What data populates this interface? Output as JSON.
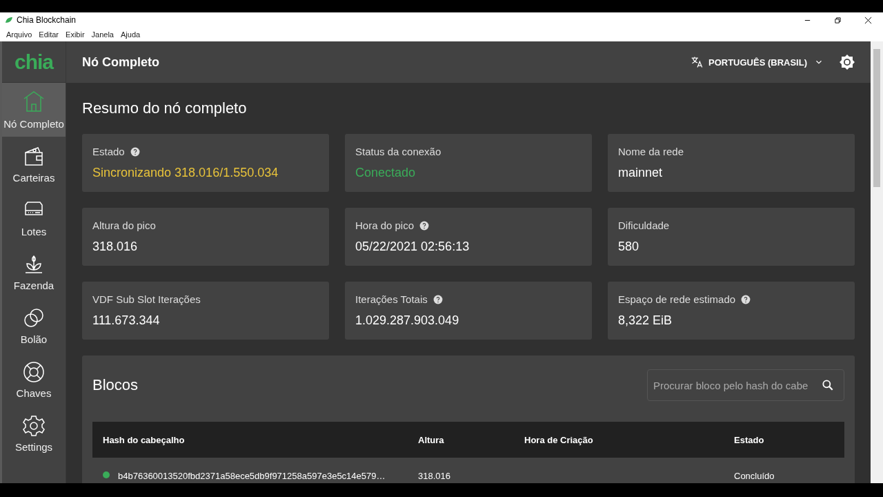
{
  "window": {
    "title": "Chia Blockchain"
  },
  "menu": [
    "Arquivo",
    "Editar",
    "Exibir",
    "Janela",
    "Ajuda"
  ],
  "logo": "chia",
  "header": {
    "title": "Nó Completo",
    "language": "PORTUGUÊS (BRASIL)"
  },
  "sidebar": {
    "items": [
      {
        "label": "Nó Completo",
        "selected": true
      },
      {
        "label": "Carteiras",
        "selected": false
      },
      {
        "label": "Lotes",
        "selected": false
      },
      {
        "label": "Fazenda",
        "selected": false
      },
      {
        "label": "Bolão",
        "selected": false
      },
      {
        "label": "Chaves",
        "selected": false
      },
      {
        "label": "Settings",
        "selected": false
      }
    ]
  },
  "summary": {
    "title": "Resumo do nó completo",
    "cards": [
      {
        "label": "Estado",
        "help": true,
        "value": "Sincronizando 318.016/1.550.034",
        "color": "#e8c33a"
      },
      {
        "label": "Status da conexão",
        "help": false,
        "value": "Conectado",
        "color": "#3aac59"
      },
      {
        "label": "Nome da rede",
        "help": false,
        "value": "mainnet",
        "color": "#ffffff"
      },
      {
        "label": "Altura do pico",
        "help": false,
        "value": "318.016",
        "color": "#ffffff"
      },
      {
        "label": "Hora do pico",
        "help": true,
        "value": "05/22/2021 02:56:13",
        "color": "#ffffff"
      },
      {
        "label": "Dificuldade",
        "help": false,
        "value": "580",
        "color": "#ffffff"
      },
      {
        "label": "VDF Sub Slot Iterações",
        "help": false,
        "value": "111.673.344",
        "color": "#ffffff"
      },
      {
        "label": "Iterações Totais",
        "help": true,
        "value": "1.029.287.903.049",
        "color": "#ffffff"
      },
      {
        "label": "Espaço de rede estimado",
        "help": true,
        "value": "8,322 EiB",
        "color": "#ffffff"
      }
    ]
  },
  "blocks": {
    "title": "Blocos",
    "search": {
      "placeholder": "Procurar bloco pelo hash do cabe"
    },
    "table": {
      "columns": [
        "Hash do cabeçalho",
        "Altura",
        "Hora de Criação",
        "Estado"
      ],
      "rows": [
        {
          "color": "#3aac59",
          "cells": [
            "b4b76360013520fbd2371a58ece5db9f971258a597e3e5c14e579…",
            "318.016",
            "",
            "Concluído"
          ]
        }
      ]
    }
  }
}
